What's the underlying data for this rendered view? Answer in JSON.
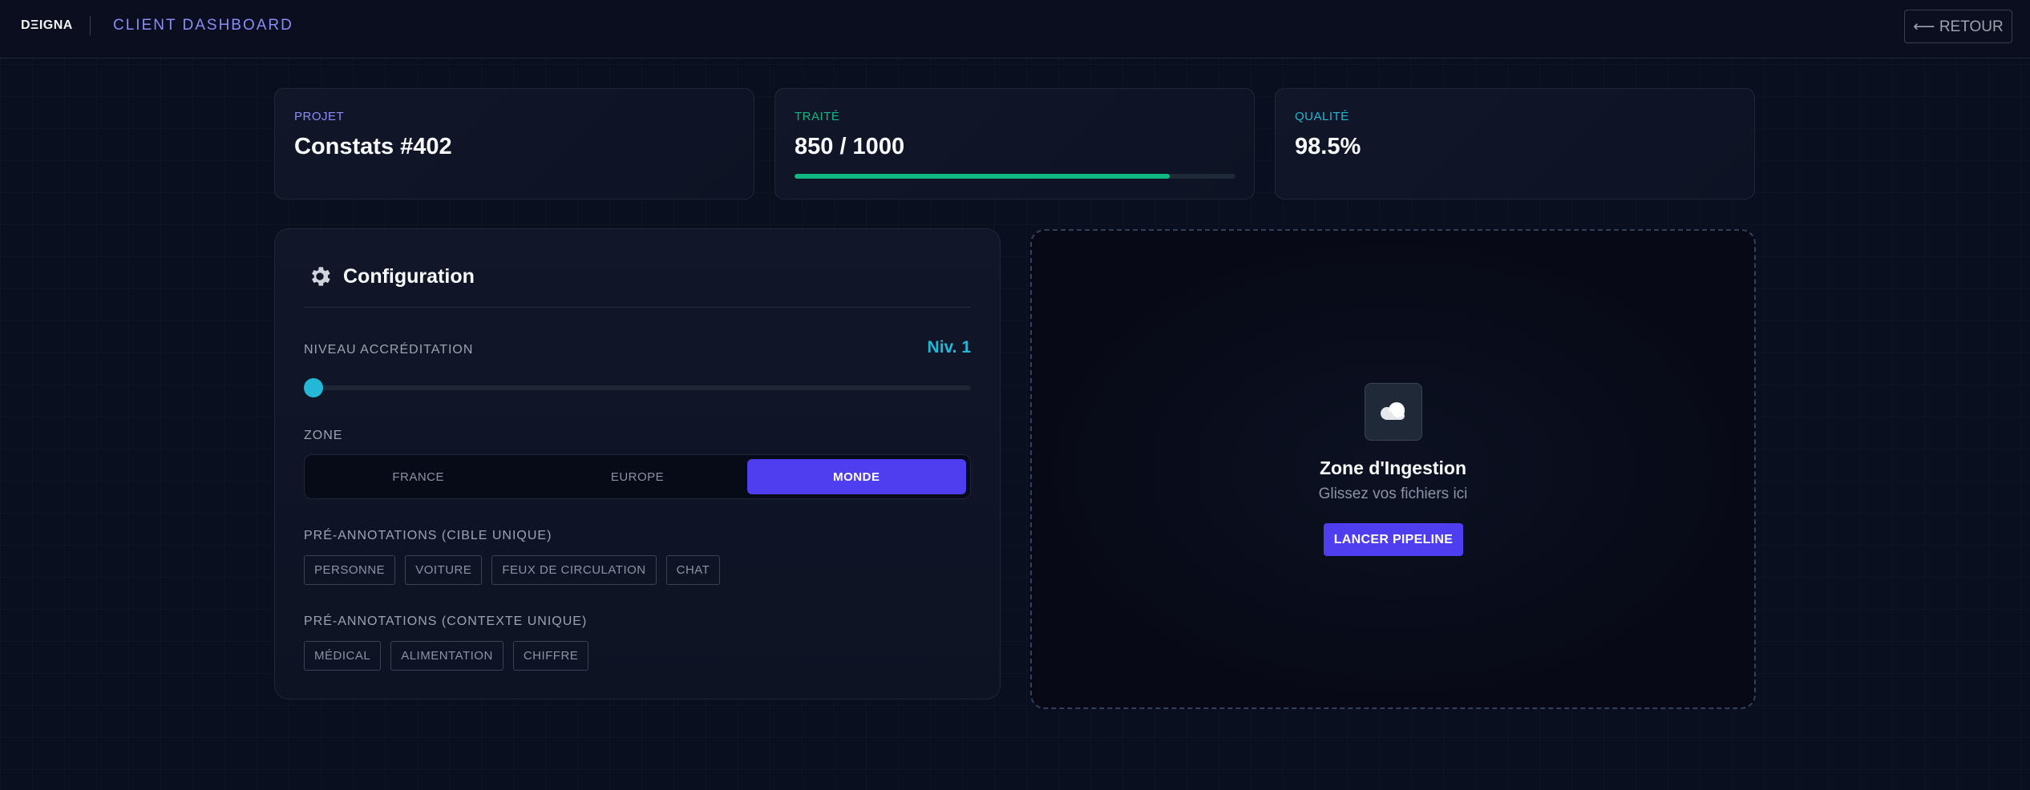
{
  "header": {
    "logo": "DΞIGNA",
    "title": "CLIENT DASHBOARD",
    "back_button": "⟵ RETOUR"
  },
  "stats": [
    {
      "label": "PROJET",
      "value": "Constats #402",
      "label_color": "#8b8cf8"
    },
    {
      "label": "TRAITÉ",
      "value": "850 / 1000",
      "label_color": "#10b981",
      "progress": 0.85
    },
    {
      "label": "QUALITÉ",
      "value": "98.5%",
      "label_color": "#22b8d6"
    }
  ],
  "config": {
    "title": "Configuration",
    "icon": "gear-icon",
    "accreditation": {
      "label": "NIVEAU ACCRÉDITATION",
      "value": "Niv. 1",
      "level": 1,
      "level_fraction": 0.0
    },
    "zone": {
      "label": "ZONE",
      "options": [
        "FRANCE",
        "EUROPE",
        "MONDE"
      ],
      "selected": "MONDE"
    },
    "target_annotations": {
      "label": "PRÉ-ANNOTATIONS (CIBLE UNIQUE)",
      "chips": [
        "PERSONNE",
        "VOITURE",
        "FEUX DE CIRCULATION",
        "CHAT"
      ]
    },
    "context_annotations": {
      "label": "PRÉ-ANNOTATIONS (CONTEXTE UNIQUE)",
      "chips": [
        "MÉDICAL",
        "ALIMENTATION",
        "CHIFFRE"
      ]
    }
  },
  "ingestion": {
    "icon": "cloud-upload-icon",
    "title": "Zone d'Ingestion",
    "subtitle": "Glissez vos fichiers ici",
    "button": "LANCER PIPELINE"
  },
  "colors": {
    "accent": "#4f3ef0",
    "cyan": "#22b8d6",
    "green": "#10b981",
    "indigo_text": "#8b8cf8",
    "background": "#0a0f1f"
  }
}
